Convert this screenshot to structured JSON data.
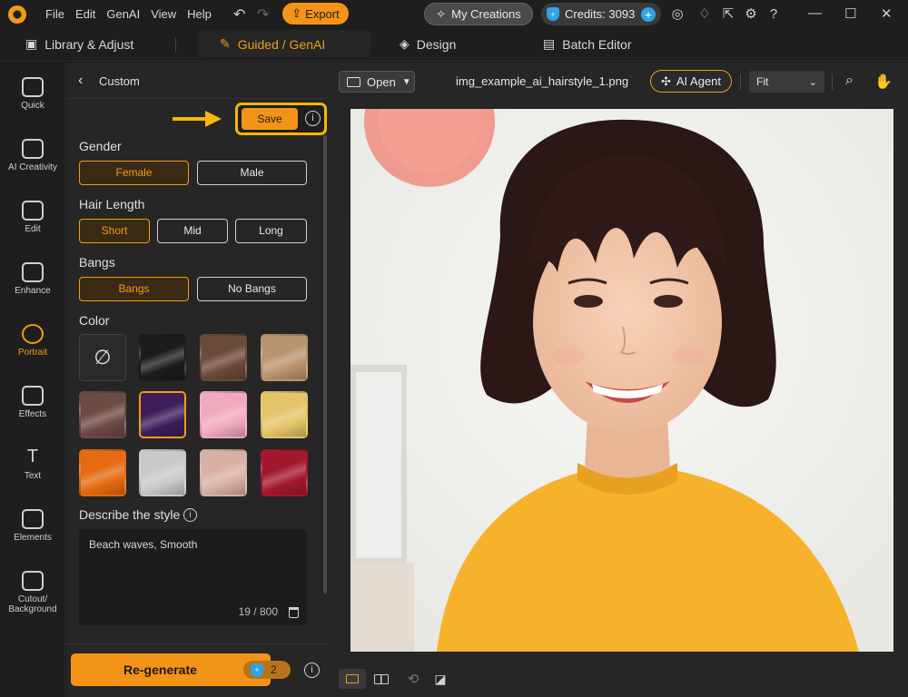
{
  "titlebar": {
    "menu": [
      "File",
      "Edit",
      "GenAI",
      "View",
      "Help"
    ],
    "export_label": "Export",
    "my_creations_label": "My Creations",
    "credits_label": "Credits: 3093"
  },
  "modes": {
    "library": "Library & Adjust",
    "guided": "Guided / GenAI",
    "design": "Design",
    "batch": "Batch Editor"
  },
  "rail": [
    {
      "label": "Quick"
    },
    {
      "label": "AI Creativity"
    },
    {
      "label": "Edit"
    },
    {
      "label": "Enhance"
    },
    {
      "label": "Portrait",
      "active": true
    },
    {
      "label": "Effects"
    },
    {
      "label": "Text"
    },
    {
      "label": "Elements"
    },
    {
      "label": "Cutout/\nBackground"
    }
  ],
  "panel": {
    "title": "Custom",
    "save_label": "Save",
    "gender": {
      "label": "Gender",
      "options": [
        "Female",
        "Male"
      ],
      "selected": "Female"
    },
    "hair_length": {
      "label": "Hair Length",
      "options": [
        "Short",
        "Mid",
        "Long"
      ],
      "selected": "Short"
    },
    "bangs": {
      "label": "Bangs",
      "options": [
        "Bangs",
        "No Bangs"
      ],
      "selected": "Bangs"
    },
    "color": {
      "label": "Color",
      "swatches": [
        "none",
        "#1c1c1c",
        "#6b4a38",
        "#b99470",
        "#6e4a44",
        "#3d1d5a",
        "#f2a9bd",
        "#e3c46a",
        "#e56a12",
        "#c9c9cc",
        "#d8b0a4",
        "#a2182f"
      ],
      "selected_index": 5
    },
    "describe": {
      "label": "Describe the style",
      "value": "Beach waves, Smooth",
      "count": "19 / 800"
    },
    "regenerate_label": "Re-generate",
    "regenerate_cost": "2"
  },
  "canvas": {
    "open_label": "Open",
    "filename": "img_example_ai_hairstyle_1.png",
    "agent_label": "AI Agent",
    "zoom_value": "Fit"
  }
}
